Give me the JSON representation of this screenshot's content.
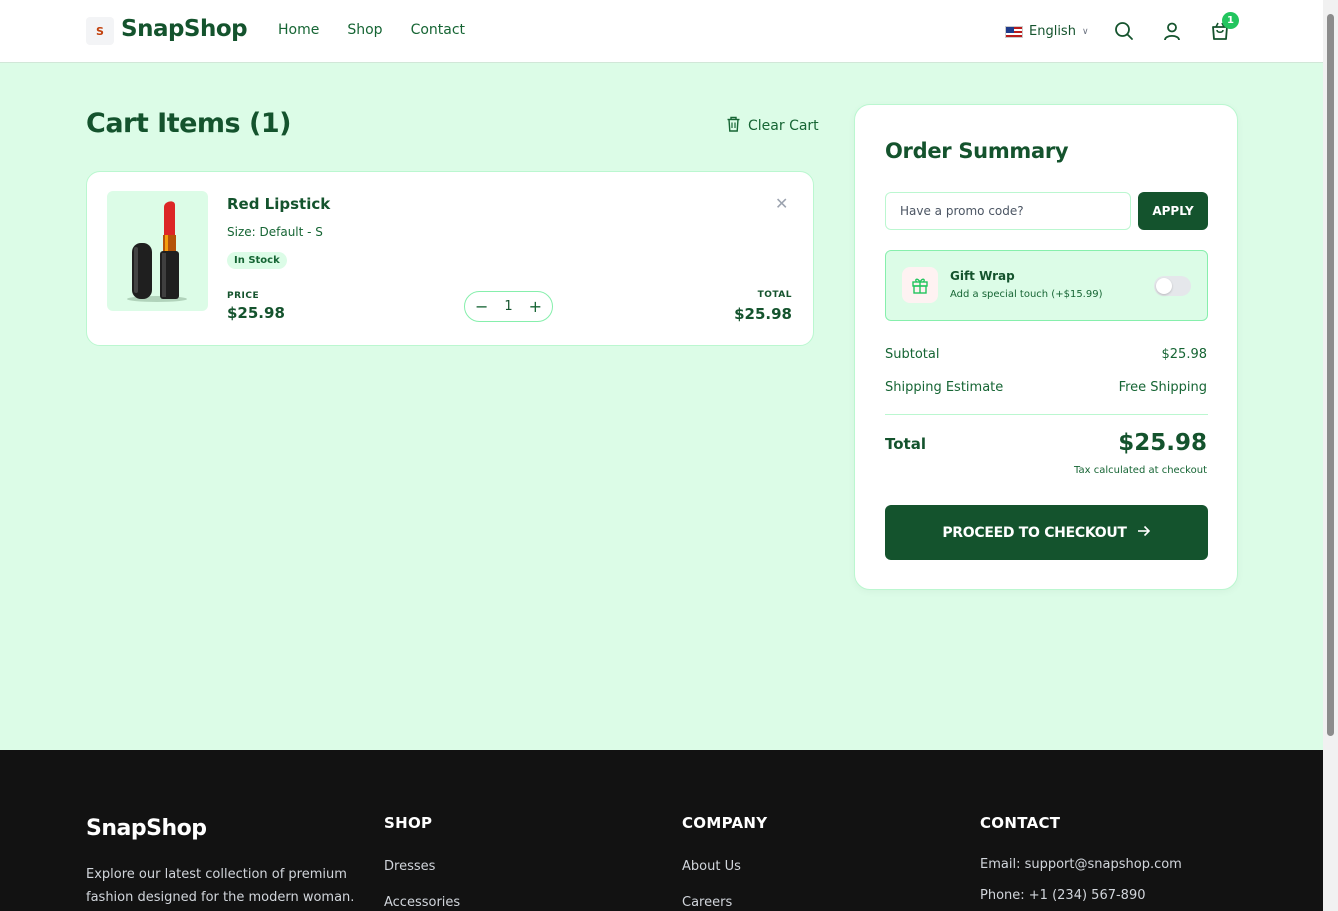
{
  "header": {
    "logo_mark": "S",
    "brand": "SnapShop",
    "nav": [
      "Home",
      "Shop",
      "Contact"
    ],
    "language": "English",
    "cart_count": "1"
  },
  "cart": {
    "title": "Cart Items (1)",
    "clear_label": "Clear Cart",
    "item": {
      "name": "Red Lipstick",
      "size": "Size: Default - S",
      "stock": "In Stock",
      "price_label": "PRICE",
      "price": "$25.98",
      "quantity": "1",
      "total_label": "TOTAL",
      "total": "$25.98"
    }
  },
  "summary": {
    "title": "Order Summary",
    "promo_placeholder": "Have a promo code?",
    "apply_label": "APPLY",
    "gift_title": "Gift Wrap",
    "gift_sub": "Add a special touch (+$15.99)",
    "gift_enabled": false,
    "subtotal_label": "Subtotal",
    "subtotal": "$25.98",
    "shipping_label": "Shipping Estimate",
    "shipping": "Free Shipping",
    "total_label": "Total",
    "total": "$25.98",
    "tax_note": "Tax calculated at checkout",
    "checkout_label": "PROCEED TO CHECKOUT"
  },
  "footer": {
    "brand": "SnapShop",
    "description": "Explore our latest collection of premium fashion designed for the modern woman.",
    "shop_title": "SHOP",
    "shop_links": [
      "Dresses",
      "Accessories"
    ],
    "company_title": "COMPANY",
    "company_links": [
      "About Us",
      "Careers"
    ],
    "contact_title": "CONTACT",
    "email": "Email: support@snapshop.com",
    "phone": "Phone: +1 (234) 567-890"
  },
  "colors": {
    "brand_green": "#14532d",
    "page_bg": "#dcfce7",
    "badge": "#22c55e",
    "footer_bg": "#121212"
  }
}
